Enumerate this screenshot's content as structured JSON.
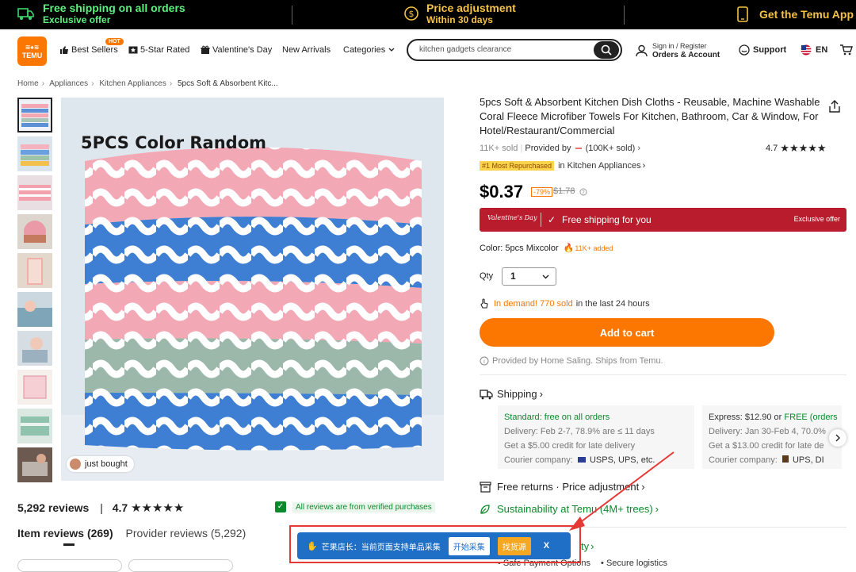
{
  "promo": {
    "shipping_title": "Free shipping on all orders",
    "shipping_sub": "Exclusive offer",
    "price_title": "Price adjustment",
    "price_sub": "Within 30 days",
    "app": "Get the Temu App"
  },
  "header": {
    "logo_text": "TEMU",
    "nav": [
      "Best Sellers",
      "5-Star Rated",
      "Valentine's Day",
      "New Arrivals",
      "Categories"
    ],
    "hot_badge": "HOT",
    "search_value": "kitchen gadgets clearance",
    "signin": "Sign in / Register",
    "orders": "Orders & Account",
    "support": "Support",
    "lang": "EN"
  },
  "breadcrumb": [
    "Home",
    "Appliances",
    "Kitchen Appliances",
    "5pcs Soft & Absorbent Kitc..."
  ],
  "gallery": {
    "overlay_text": "5PCS Color Random",
    "just_bought": "just bought"
  },
  "product": {
    "title": "5pcs Soft & Absorbent Kitchen Dish Cloths - Reusable, Machine Washable Coral Fleece Microfiber Towels For Kitchen, Bathroom, Car & Window, For Hotel/Restaurant/Commercial",
    "sold": "11K+ sold",
    "provided_by": "Provided by",
    "provider_sold": "(100K+ sold)",
    "rating": "4.7",
    "stars": 4.7,
    "rank_tag": "#1 Most Repurchased",
    "rank_cat": "in Kitchen Appliances",
    "price": "$0.37",
    "discount": "-79%",
    "old_price": "$1.78",
    "vday_logo": "Valentine's Day",
    "free_ship": "Free shipping for you",
    "exclusive": "Exclusive offer",
    "color_label": "Color: 5pcs Mixcolor",
    "color_added": "11K+ added",
    "qty_label": "Qty",
    "qty_value": "1",
    "demand_hot": "In demand! 770 sold",
    "demand_rest": "in the last 24 hours",
    "add_to_cart": "Add to cart",
    "provided_note": "Provided by Home Saling. Ships from Temu."
  },
  "shipping": {
    "title": "Shipping",
    "standard": {
      "head": "Standard: free on all orders",
      "delivery": "Delivery: Feb 2-7, 78.9% are ≤ 11 days",
      "credit": "Get a $5.00 credit for late delivery",
      "courier": "Courier company:",
      "couriers": "USPS, UPS, etc."
    },
    "express": {
      "head_a": "Express: $12.90 or",
      "head_b": "FREE (orders",
      "delivery": "Delivery: Jan 30-Feb 4, 70.0%",
      "credit": "Get a $13.00 credit for late de",
      "courier": "Courier company:",
      "couriers": "UPS, DI"
    }
  },
  "policies": {
    "returns": "Free returns · Price adjustment",
    "sustain": "Sustainability at Temu (4M+ trees)",
    "secure_a": "Safe Payment Options",
    "secure_b": "Secure logistics",
    "security_tail": "ty"
  },
  "reviews": {
    "count": "5,292 reviews",
    "rating": "4.7",
    "verified": "All reviews are from verified purchases",
    "tab_item": "Item reviews (269)",
    "tab_provider": "Provider reviews (5,292)"
  },
  "plugin": {
    "text": "芒果店长：当前页面支持单品采集",
    "btn_collect": "开始采集",
    "btn_find": "找货源",
    "close": "X"
  }
}
